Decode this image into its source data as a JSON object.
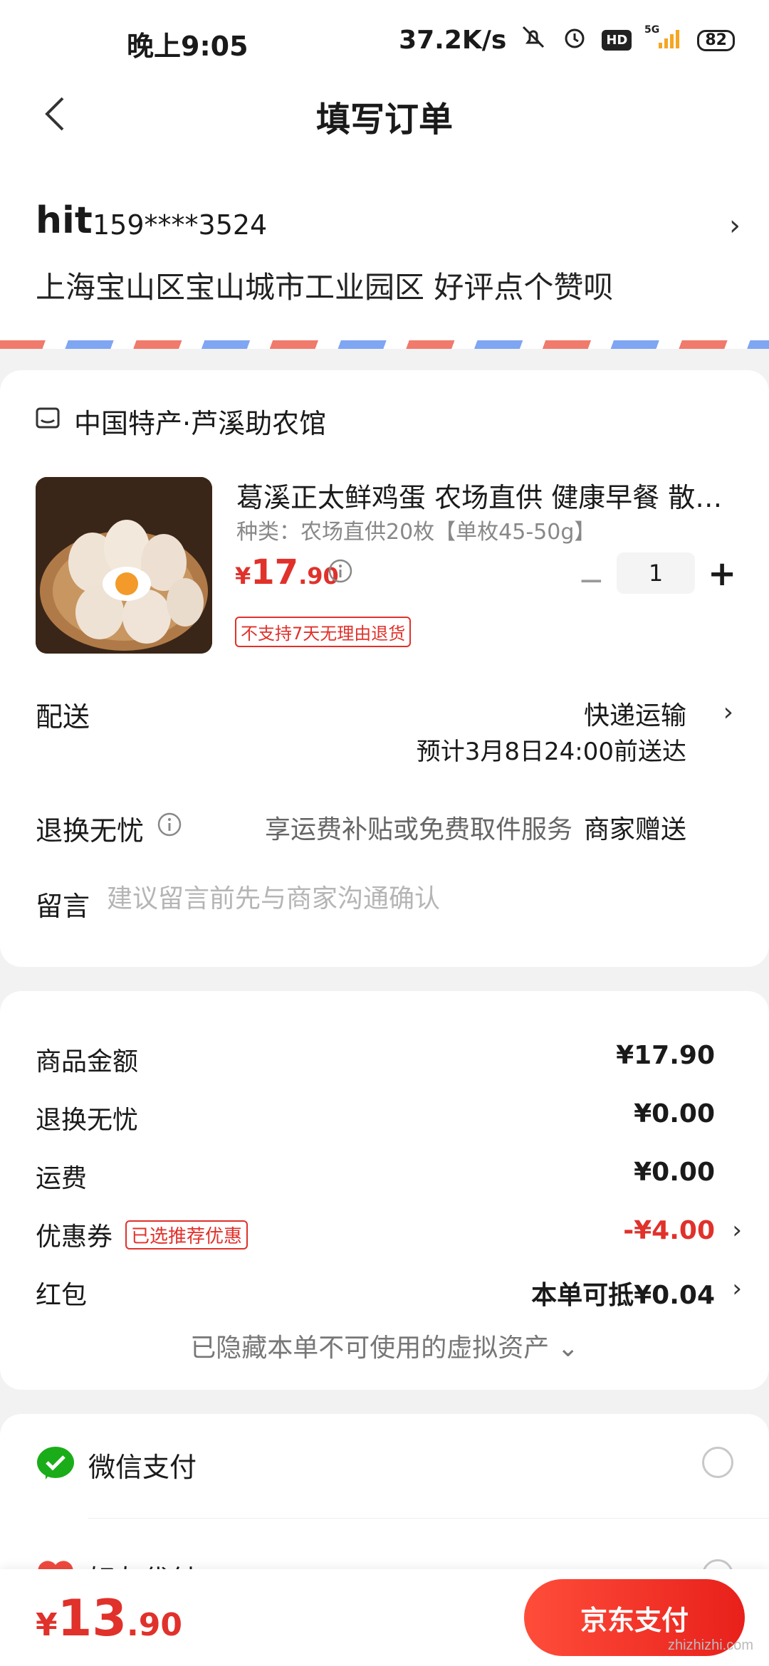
{
  "status_bar": {
    "time": "晚上9:05",
    "network_speed": "37.2K/s",
    "network_type": "5G",
    "battery": "82",
    "icons": [
      "mute-icon",
      "alarm-icon",
      "hd-icon",
      "signal-icon",
      "battery-icon"
    ]
  },
  "nav": {
    "title": "填写订单"
  },
  "address": {
    "name": "hit",
    "phone": "159****3524",
    "line": "上海宝山区宝山城市工业园区 好评点个赞呗"
  },
  "shop": {
    "name": "中国特产·芦溪助农馆",
    "product": {
      "title": "葛溪正太鲜鸡蛋 农场直供 健康早餐 散养土鸡蛋",
      "spec": "种类：农场直供20枚【单枚45-50g】",
      "price_symbol": "¥",
      "price_int": "17",
      "price_dec": ".90",
      "quantity": "1",
      "minus": "−",
      "plus": "+",
      "tag": "不支持7天无理由退货"
    },
    "delivery": {
      "label": "配送",
      "method": "快递运输",
      "eta": "预计3月8日24:00前送达"
    },
    "return": {
      "label": "退换无忧",
      "desc": "享运费补贴或免费取件服务",
      "value": "商家赠送"
    },
    "message": {
      "label": "留言",
      "placeholder": "建议留言前先与商家沟通确认"
    }
  },
  "summary": {
    "goods_label": "商品金额",
    "goods_value": "¥17.90",
    "return_label": "退换无忧",
    "return_value": "¥0.00",
    "shipping_label": "运费",
    "shipping_value": "¥0.00",
    "coupon_label": "优惠券",
    "coupon_tag": "已选推荐优惠",
    "coupon_value": "-¥4.00",
    "redpacket_label": "红包",
    "redpacket_value": "本单可抵¥0.04",
    "hidden_assets": "已隐藏本单不可使用的虚拟资产 ⌄"
  },
  "payment": {
    "options": [
      {
        "label": "微信支付"
      },
      {
        "label": "好友代付"
      }
    ]
  },
  "bottom": {
    "price_symbol": "¥",
    "price_int": "13",
    "price_dec": ".90",
    "pay_button": "京东支付",
    "watermark": "zhizhizhi.com"
  },
  "colors": {
    "accent_red": "#e0312b",
    "wechat_green": "#1aad19"
  }
}
